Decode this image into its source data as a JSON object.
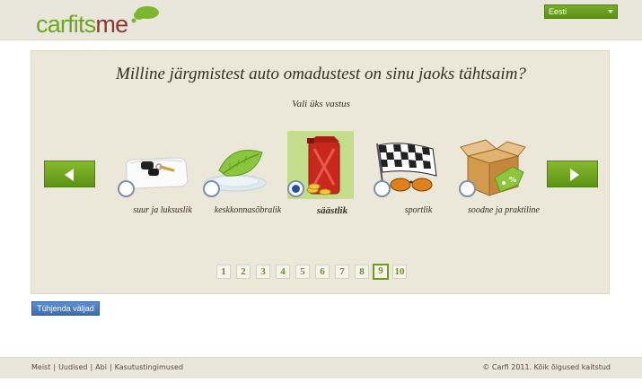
{
  "header": {
    "logo": {
      "part1": "carfits",
      "part2": "me"
    },
    "language": {
      "selected": "Eesti"
    }
  },
  "quiz": {
    "question": "Milline järgmistest auto omadustest on sinu jaoks tähtsaim?",
    "instruction": "Vali üks vastus",
    "options": [
      {
        "label": "suur ja luksuslik",
        "icon": "pillow-keys-icon"
      },
      {
        "label": "keskkonnasõbralik",
        "icon": "leaf-plate-icon"
      },
      {
        "label": "säästlik",
        "icon": "fuel-can-coins-icon",
        "selected": true
      },
      {
        "label": "sportlik",
        "icon": "checkered-flag-sunglasses-icon"
      },
      {
        "label": "soodne ja praktiline",
        "icon": "box-discount-tag-icon"
      }
    ],
    "pagination": {
      "pages": [
        "1",
        "2",
        "3",
        "4",
        "5",
        "6",
        "7",
        "8",
        "9",
        "10"
      ],
      "current": "9"
    }
  },
  "actions": {
    "clear_label": "Tühjenda väljad"
  },
  "footer": {
    "links": [
      "Meist",
      "Uudised",
      "Abi",
      "Kasutustingimused"
    ],
    "copyright": "© Carfi 2011. Kõik õigused kaitstud"
  },
  "colors": {
    "accent_green": "#6fa81e",
    "brand_brown": "#8a3a2f",
    "clear_blue": "#3b6fb5",
    "panel_bg": "#ebe7d9"
  }
}
